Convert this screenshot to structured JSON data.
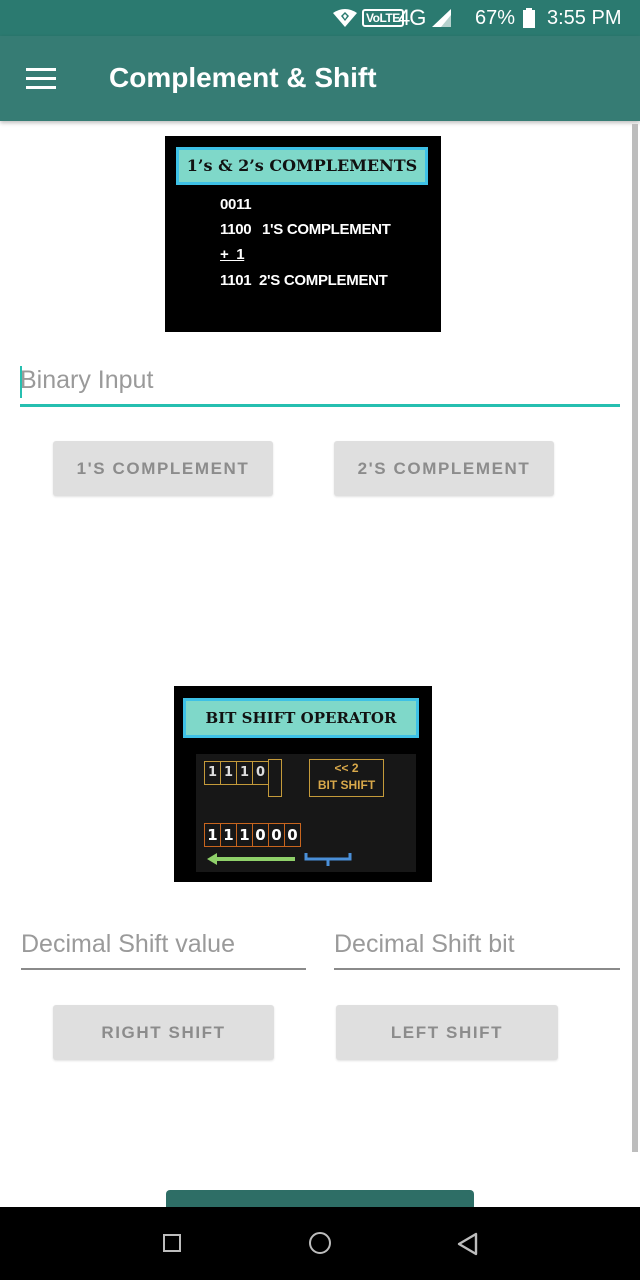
{
  "status_bar": {
    "volte": "VoLTE",
    "network": "4G",
    "battery_percent": "67%",
    "time": "3:55 PM",
    "icons": [
      "wifi-icon",
      "signal-icon",
      "battery-icon"
    ]
  },
  "toolbar": {
    "title": "Complement & Shift",
    "menu_icon": "menu-icon"
  },
  "complement_image": {
    "title": "1’s & 2’s COMPLEMENTS",
    "line1": "0011",
    "line2_value": "1100",
    "line2_label": "1'S COMPLEMENT",
    "line3": "+  1",
    "line4_value": "1101",
    "line4_label": "2'S COMPLEMENT"
  },
  "binary_input": {
    "placeholder": "Binary Input",
    "value": ""
  },
  "complement_buttons": {
    "ones": "1'S COMPLEMENT",
    "twos": "2'S COMPLEMENT"
  },
  "shift_image": {
    "title": "BIT SHIFT OPERATOR",
    "top_bits": [
      "1",
      "1",
      "1",
      "0"
    ],
    "shift_label_line1": "<< 2",
    "shift_label_line2": "BIT SHIFT",
    "result_bits": [
      "1",
      "1",
      "1",
      "0",
      "0",
      "0"
    ]
  },
  "shift_inputs": {
    "value_placeholder": "Decimal Shift value",
    "bit_placeholder": "Decimal Shift bit"
  },
  "shift_buttons": {
    "right": "RIGHT SHIFT",
    "left": "LEFT SHIFT"
  },
  "colors": {
    "primary": "#367c74",
    "status_bar": "#2b7a70",
    "accent": "#26bfb0",
    "image_title_bg": "#7fd8c9"
  }
}
